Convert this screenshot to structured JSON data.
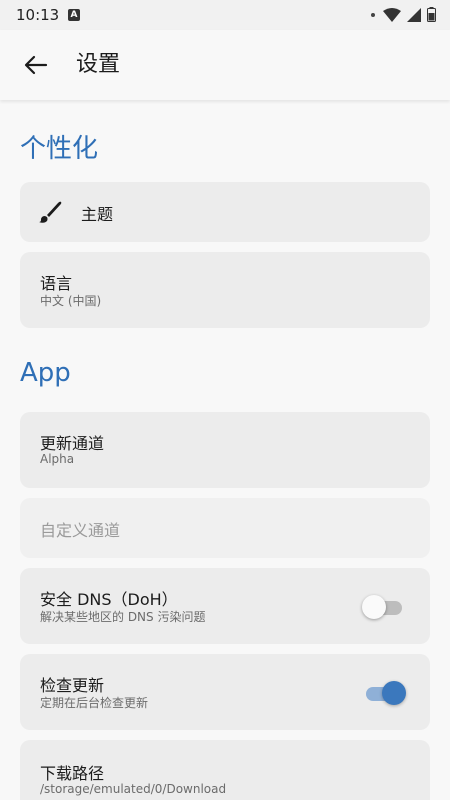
{
  "status_bar": {
    "time": "10:13",
    "notif_letter": "A"
  },
  "app_bar": {
    "title": "设置"
  },
  "sections": {
    "personalize": "个性化",
    "app": "App"
  },
  "items": {
    "theme": {
      "title": "主题"
    },
    "language": {
      "title": "语言",
      "subtitle": "中文 (中国)"
    },
    "update_channel": {
      "title": "更新通道",
      "subtitle": "Alpha"
    },
    "custom_channel": {
      "title": "自定义通道"
    },
    "secure_dns": {
      "title": "安全 DNS（DoH）",
      "subtitle": "解决某些地区的 DNS 污染问题",
      "enabled": false
    },
    "check_updates": {
      "title": "检查更新",
      "subtitle": "定期在后台检查更新",
      "enabled": true
    },
    "download_path": {
      "title": "下载路径",
      "subtitle": "/storage/emulated/0/Download"
    }
  },
  "colors": {
    "accent": "#2f6fb6",
    "switch_on": "#3b78bd",
    "card_bg": "#ececec"
  }
}
